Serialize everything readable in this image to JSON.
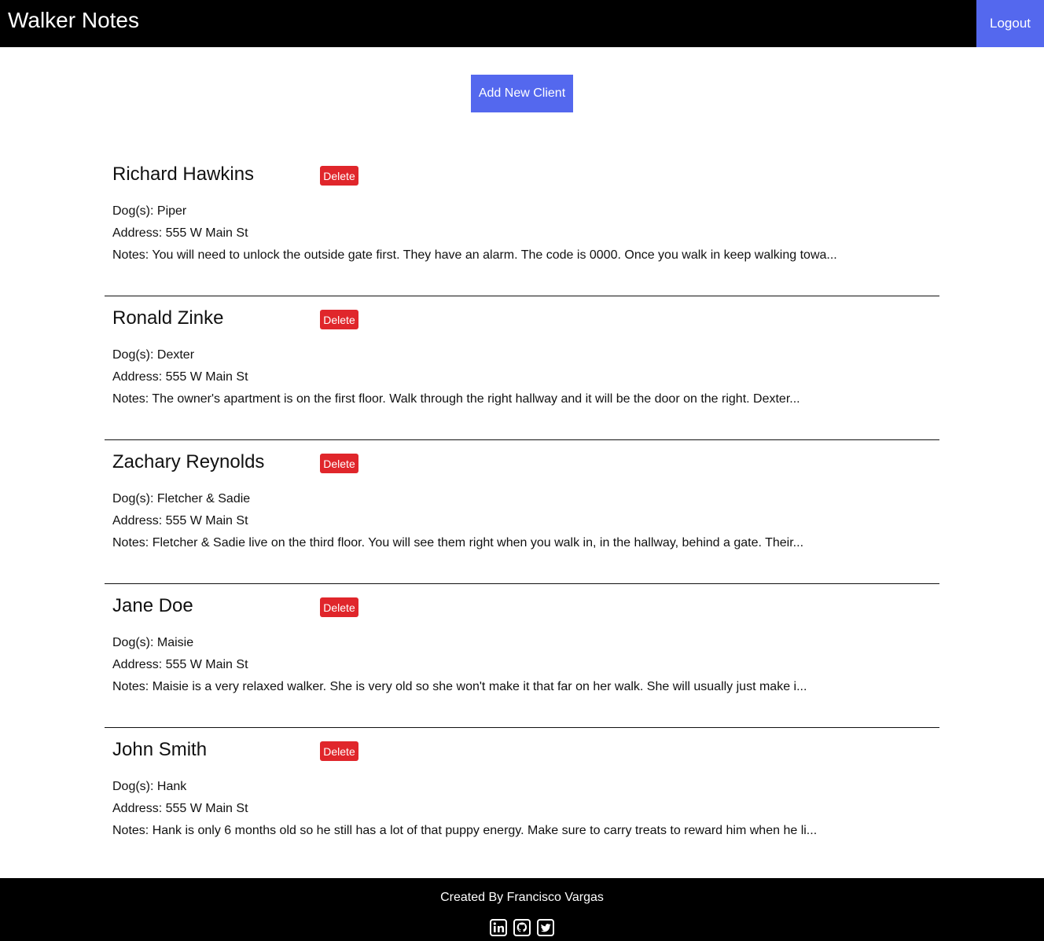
{
  "navbar": {
    "brand": "Walker Notes",
    "logout_label": "Logout"
  },
  "actions": {
    "add_client_label": "Add New Client"
  },
  "clients": [
    {
      "name": "Richard Hawkins",
      "delete_label": "Delete",
      "dogs": "Dog(s): Piper",
      "address": "Address: 555 W Main St",
      "notes": "Notes: You will need to unlock the outside gate first. They have an alarm. The code is 0000. Once you walk in keep walking towa..."
    },
    {
      "name": "Ronald Zinke",
      "delete_label": "Delete",
      "dogs": "Dog(s): Dexter",
      "address": "Address: 555 W Main St",
      "notes": "Notes: The owner's apartment is on the first floor. Walk through the right hallway and it will be the door on the right. Dexter..."
    },
    {
      "name": "Zachary Reynolds",
      "delete_label": "Delete",
      "dogs": "Dog(s): Fletcher & Sadie",
      "address": "Address: 555 W Main St",
      "notes": "Notes: Fletcher & Sadie live on the third floor. You will see them right when you walk in, in the hallway, behind a gate. Their..."
    },
    {
      "name": "Jane Doe",
      "delete_label": "Delete",
      "dogs": "Dog(s): Maisie",
      "address": "Address: 555 W Main St",
      "notes": "Notes: Maisie is a very relaxed walker. She is very old so she won't make it that far on her walk. She will usually just make i..."
    },
    {
      "name": "John Smith",
      "delete_label": "Delete",
      "dogs": "Dog(s): Hank",
      "address": "Address: 555 W Main St",
      "notes": "Notes: Hank is only 6 months old so he still has a lot of that puppy energy. Make sure to carry treats to reward him when he li..."
    }
  ],
  "footer": {
    "credit": "Created By Francisco Vargas",
    "social_icons": [
      "linkedin-icon",
      "github-icon",
      "twitter-icon"
    ]
  },
  "colors": {
    "navbar_bg": "#000000",
    "primary_button": "#5468ee",
    "delete_button": "#e0262b",
    "footer_bg": "#000000"
  }
}
